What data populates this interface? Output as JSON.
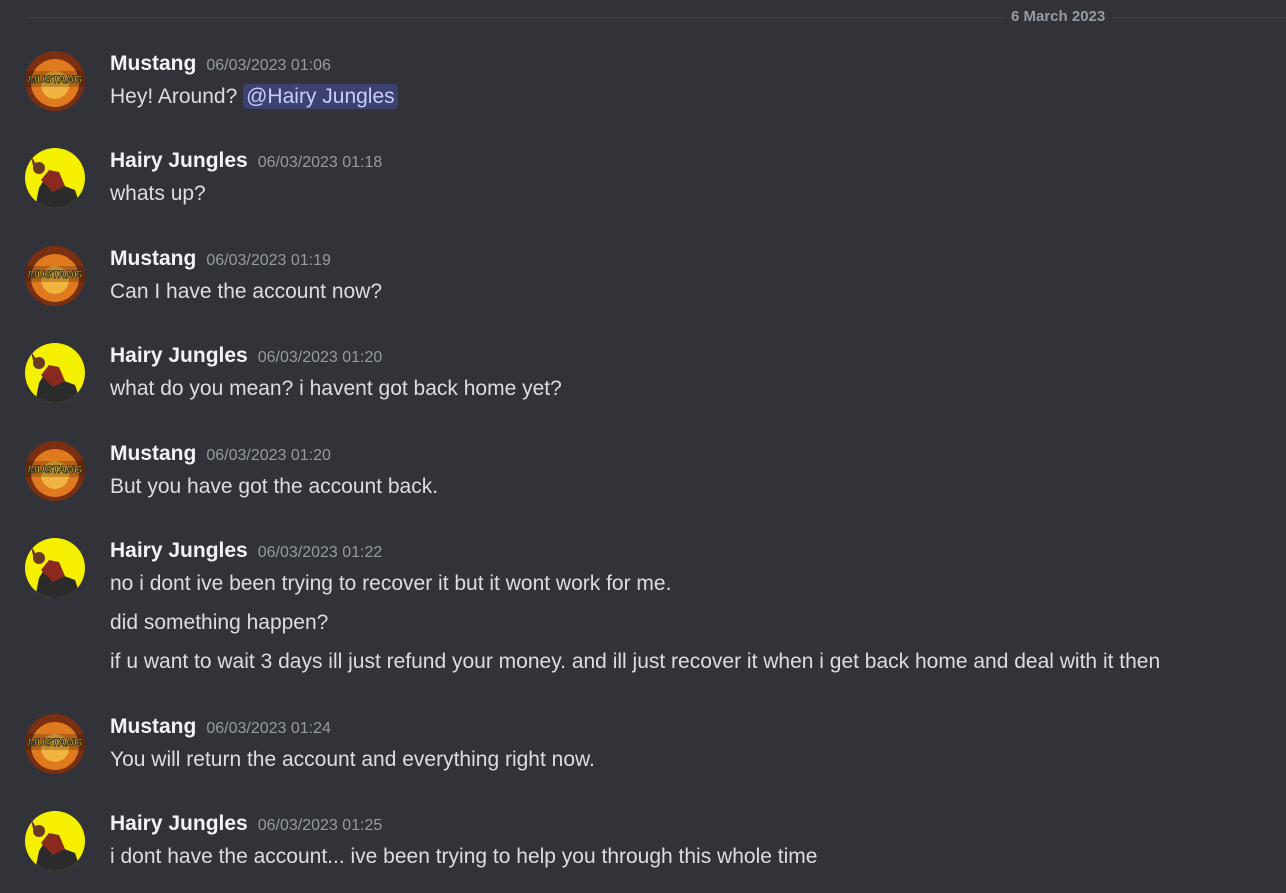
{
  "date_divider": "6 March 2023",
  "messages": [
    {
      "author": "Mustang",
      "time": "06/03/2023 01:06",
      "avatar": "mustang-logo-avatar",
      "lines": [
        "Hey! Around?"
      ],
      "mention": "@Hairy Jungles"
    },
    {
      "author": "Hairy Jungles",
      "time": "06/03/2023 01:18",
      "avatar": "yellow-figure-avatar",
      "lines": [
        "whats up?"
      ]
    },
    {
      "author": "Mustang",
      "time": "06/03/2023 01:19",
      "avatar": "mustang-logo-avatar",
      "lines": [
        "Can I have the account now?"
      ]
    },
    {
      "author": "Hairy Jungles",
      "time": "06/03/2023 01:20",
      "avatar": "yellow-figure-avatar",
      "lines": [
        "what do you mean? i havent got back home yet?"
      ]
    },
    {
      "author": "Mustang",
      "time": "06/03/2023 01:20",
      "avatar": "mustang-logo-avatar",
      "lines": [
        "But you have got the account back."
      ]
    },
    {
      "author": "Hairy Jungles",
      "time": "06/03/2023 01:22",
      "avatar": "yellow-figure-avatar",
      "lines": [
        "no i dont ive been trying to recover it but it wont work for me.",
        "did something happen?",
        "if u want to wait 3 days ill just refund your money. and ill just recover it when i get back home and deal with it then"
      ]
    },
    {
      "author": "Mustang",
      "time": "06/03/2023 01:24",
      "avatar": "mustang-logo-avatar",
      "lines": [
        "You will return the account and everything right now."
      ]
    },
    {
      "author": "Hairy Jungles",
      "time": "06/03/2023 01:25",
      "avatar": "yellow-figure-avatar",
      "lines": [
        "i dont have the account... ive been trying to help you through this whole time"
      ]
    }
  ],
  "avatar_text": "MUSTANG",
  "colors": {
    "background": "#313338",
    "text": "#dbdee1",
    "muted": "#949ba4",
    "mention": "#c9cdfb"
  }
}
